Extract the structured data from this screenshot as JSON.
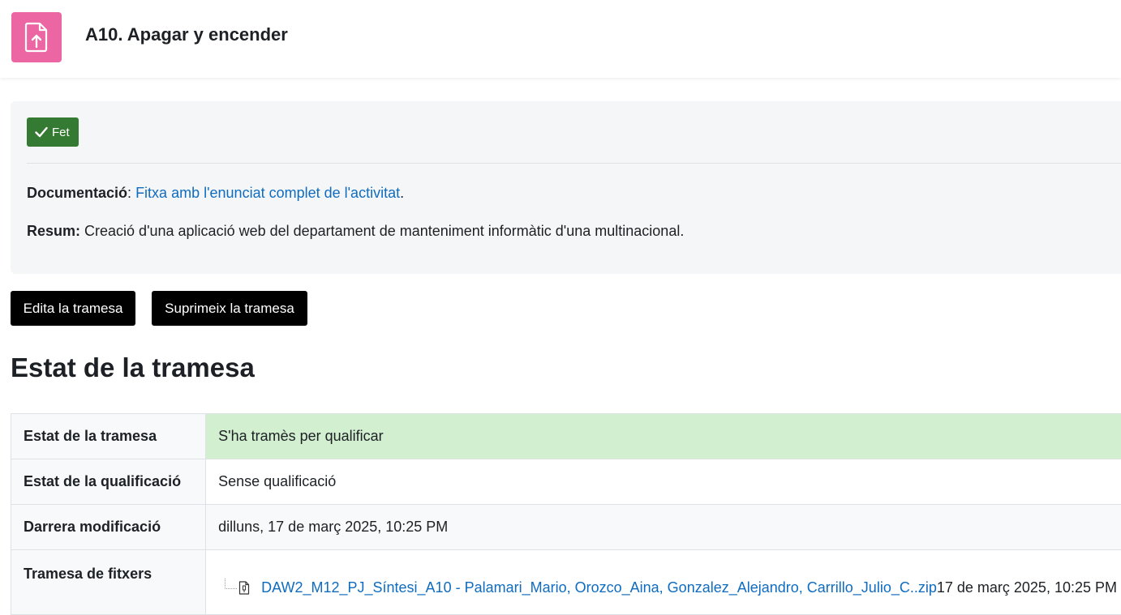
{
  "header": {
    "icon": "assignment-upload-icon",
    "icon_color": "#eb66a2",
    "title": "A10. Apagar y encender"
  },
  "completion": {
    "badge_icon": "check-icon",
    "badge_label": "Fet",
    "badge_color": "#357a32"
  },
  "description": {
    "doc_label": "Documentació",
    "doc_separator": ":",
    "doc_link_text": "Fitxa amb l'enunciat complet de l'activitat",
    "doc_trailing": ".",
    "summary_label": "Resum:",
    "summary_text": "Creació d'una aplicació web del departament de manteniment informàtic d'una multinacional."
  },
  "actions": {
    "edit_label": "Edita la tramesa",
    "delete_label": "Suprimeix la tramesa"
  },
  "submission_status": {
    "heading": "Estat de la tramesa",
    "rows": [
      {
        "label": "Estat de la tramesa",
        "value": "S'ha tramès per qualificar",
        "highlight_color": "#d2efd0"
      },
      {
        "label": "Estat de la qualificació",
        "value": "Sense qualificació"
      },
      {
        "label": "Darrera modificació",
        "value": "dilluns, 17 de març 2025, 10:25 PM"
      },
      {
        "label": "Tramesa de fitxers",
        "file": {
          "icon": "archive-file-icon",
          "name": "DAW2_M12_PJ_Síntesi_A10 - Palamari_Mario, Orozco_Aina, Gonzalez_Alejandro, Carrillo_Julio_C..zip",
          "date": "17 de març 2025, 10:25 PM"
        }
      }
    ]
  },
  "colors": {
    "link": "#0f6cbf",
    "button_bg": "#000000"
  }
}
